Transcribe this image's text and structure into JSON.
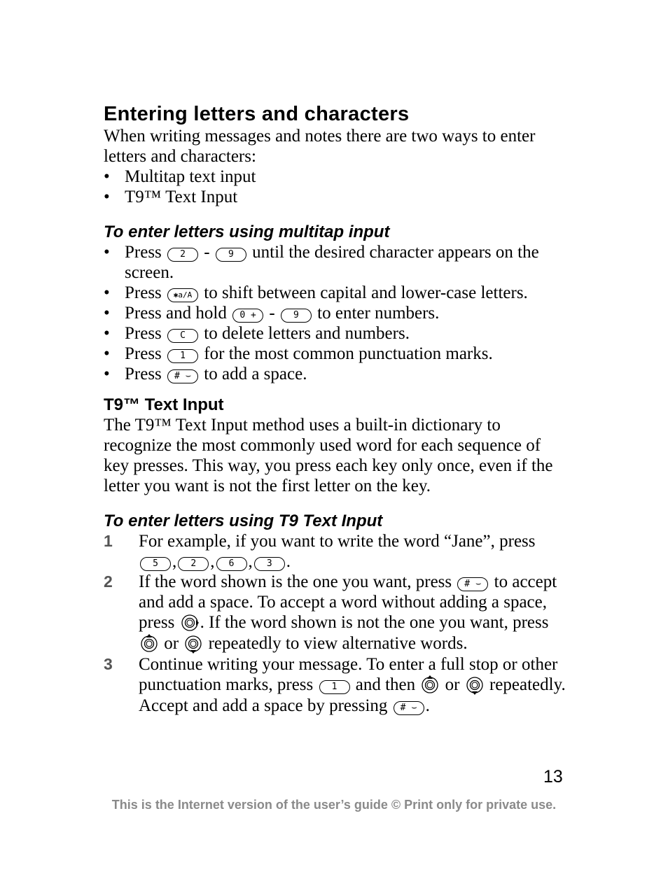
{
  "heading": "Entering letters and characters",
  "intro": "When writing messages and notes there are two ways to enter letters and characters:",
  "methods": [
    "Multitap text input",
    "T9™ Text Input"
  ],
  "multitap": {
    "title": "To enter letters using multitap input",
    "items": [
      {
        "pre": "Press",
        "key1": "2",
        "sep": "-",
        "key2": "9",
        "post": "until the desired character appears on the screen."
      },
      {
        "pre": "Press",
        "key1": "✱a/A",
        "post": "to shift between capital and lower-case letters."
      },
      {
        "pre": "Press and hold",
        "key1": "0 +",
        "sep": "-",
        "key2": "9",
        "post": "to enter numbers."
      },
      {
        "pre": "Press",
        "key1": "C",
        "post": "to delete letters and numbers."
      },
      {
        "pre": "Press",
        "key1": "1",
        "post": "for the most common punctuation marks."
      },
      {
        "pre": "Press",
        "key1": "# ⌣",
        "post": "to add a space."
      }
    ]
  },
  "t9": {
    "title": "T9™ Text Input",
    "body": "The T9™ Text Input method uses a built-in dictionary to recognize the most commonly used word for each sequence of key presses. This way, you press each key only once, even if the letter you want is not the first letter on the key."
  },
  "t9steps": {
    "title": "To enter letters using T9 Text Input",
    "steps": [
      {
        "num": "1",
        "text_a": "For example, if you want to write the word “Jane”, press",
        "keys": [
          "5",
          "2",
          "6",
          "3"
        ]
      },
      {
        "num": "2",
        "text_a": "If the word shown is the one you want, press",
        "key": "# ⌣",
        "text_b": "to accept and add a space. To accept a word without adding a space, press",
        "text_c": ". If the word shown is not the one you want, press",
        "text_d": "or",
        "text_e": "repeatedly to view alternative words."
      },
      {
        "num": "3",
        "text_a": "Continue writing your message. To enter a full stop or other punctuation marks, press",
        "key": "1",
        "text_b": "and then",
        "text_c": "or",
        "text_d": "repeatedly. Accept and add a space by pressing",
        "key2": "# ⌣",
        "text_e": "."
      }
    ]
  },
  "page_number": "13",
  "footer": "This is the Internet version of the user’s guide © Print only for private use."
}
